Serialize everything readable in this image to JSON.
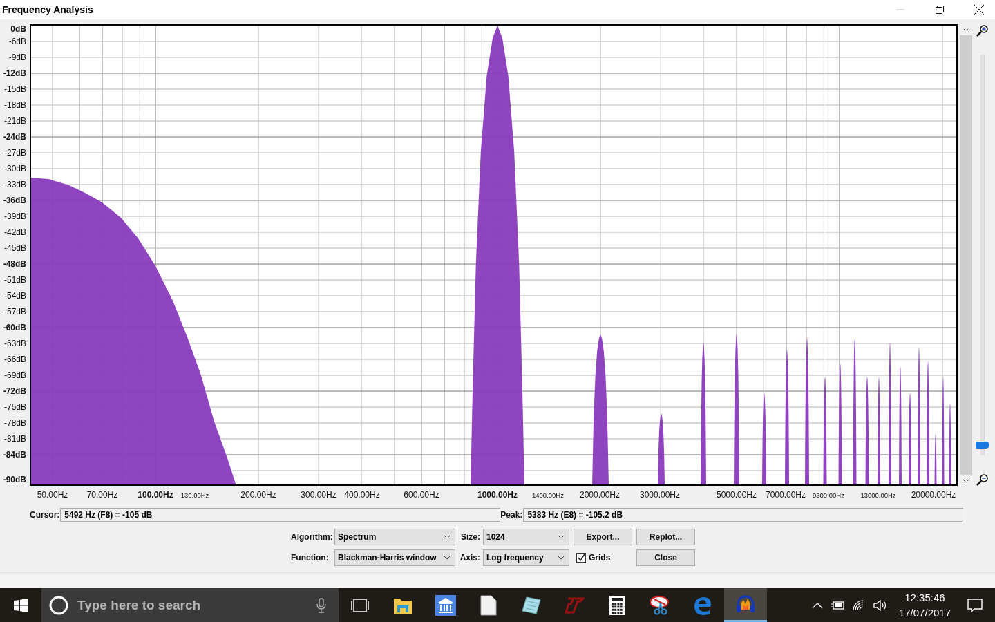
{
  "window": {
    "title": "Frequency Analysis"
  },
  "y_axis_labels": [
    {
      "text": "0dB",
      "kind": "major"
    },
    {
      "text": "-6dB",
      "kind": "normal"
    },
    {
      "text": "-9dB",
      "kind": "normal"
    },
    {
      "text": "-12dB",
      "kind": "major"
    },
    {
      "text": "-15dB",
      "kind": "normal"
    },
    {
      "text": "-18dB",
      "kind": "normal"
    },
    {
      "text": "-21dB",
      "kind": "normal"
    },
    {
      "text": "-24dB",
      "kind": "major"
    },
    {
      "text": "-27dB",
      "kind": "normal"
    },
    {
      "text": "-30dB",
      "kind": "normal"
    },
    {
      "text": "-33dB",
      "kind": "normal"
    },
    {
      "text": "-36dB",
      "kind": "major"
    },
    {
      "text": "-39dB",
      "kind": "normal"
    },
    {
      "text": "-42dB",
      "kind": "normal"
    },
    {
      "text": "-45dB",
      "kind": "normal"
    },
    {
      "text": "-48dB",
      "kind": "major"
    },
    {
      "text": "-51dB",
      "kind": "normal"
    },
    {
      "text": "-54dB",
      "kind": "normal"
    },
    {
      "text": "-57dB",
      "kind": "normal"
    },
    {
      "text": "-60dB",
      "kind": "major"
    },
    {
      "text": "-63dB",
      "kind": "normal"
    },
    {
      "text": "-66dB",
      "kind": "normal"
    },
    {
      "text": "-69dB",
      "kind": "normal"
    },
    {
      "text": "-72dB",
      "kind": "major"
    },
    {
      "text": "-75dB",
      "kind": "normal"
    },
    {
      "text": "-78dB",
      "kind": "normal"
    },
    {
      "text": "-81dB",
      "kind": "normal"
    },
    {
      "text": "-84dB",
      "kind": "major"
    },
    {
      "text": "-90dB",
      "kind": "major"
    }
  ],
  "x_axis_labels": [
    {
      "text": "50.00Hz",
      "kind": "normal"
    },
    {
      "text": "70.00Hz",
      "kind": "normal"
    },
    {
      "text": "100.00Hz",
      "kind": "major"
    },
    {
      "text": "130.00Hz",
      "kind": "minor"
    },
    {
      "text": "200.00Hz",
      "kind": "normal"
    },
    {
      "text": "300.00Hz",
      "kind": "normal"
    },
    {
      "text": "400.00Hz",
      "kind": "normal"
    },
    {
      "text": "600.00Hz",
      "kind": "normal"
    },
    {
      "text": "1000.00Hz",
      "kind": "major"
    },
    {
      "text": "1400.00Hz",
      "kind": "minor"
    },
    {
      "text": "2000.00Hz",
      "kind": "normal"
    },
    {
      "text": "3000.00Hz",
      "kind": "normal"
    },
    {
      "text": "5000.00Hz",
      "kind": "normal"
    },
    {
      "text": "7000.00Hz",
      "kind": "normal"
    },
    {
      "text": "9300.00Hz",
      "kind": "minor"
    },
    {
      "text": "13000.00Hz",
      "kind": "minor"
    },
    {
      "text": "20000.00Hz",
      "kind": "normal"
    }
  ],
  "zoom_slider": {
    "level": 0
  },
  "cursor": {
    "label": "Cursor:",
    "value": "5492 Hz (F8) = -105 dB"
  },
  "peak": {
    "label": "Peak:",
    "value": "5383 Hz (E8) = -105.2 dB"
  },
  "algorithm": {
    "label": "Algorithm:",
    "value": "Spectrum"
  },
  "size": {
    "label": "Size:",
    "value": "1024"
  },
  "function": {
    "label": "Function:",
    "value": "Blackman-Harris window"
  },
  "axis": {
    "label": "Axis:",
    "value": "Log frequency"
  },
  "grids": {
    "label": "Grids",
    "checked": true
  },
  "buttons": {
    "export": "Export...",
    "replot": "Replot...",
    "close": "Close"
  },
  "taskbar": {
    "search_placeholder": "Type here to search",
    "apps": [
      {
        "selected": false
      },
      {
        "selected": false
      },
      {
        "selected": false
      },
      {
        "selected": false
      },
      {
        "selected": false
      },
      {
        "selected": false
      },
      {
        "selected": false
      },
      {
        "selected": false
      },
      {
        "selected": true
      }
    ],
    "time": "12:35:46",
    "date": "17/07/2017"
  }
}
